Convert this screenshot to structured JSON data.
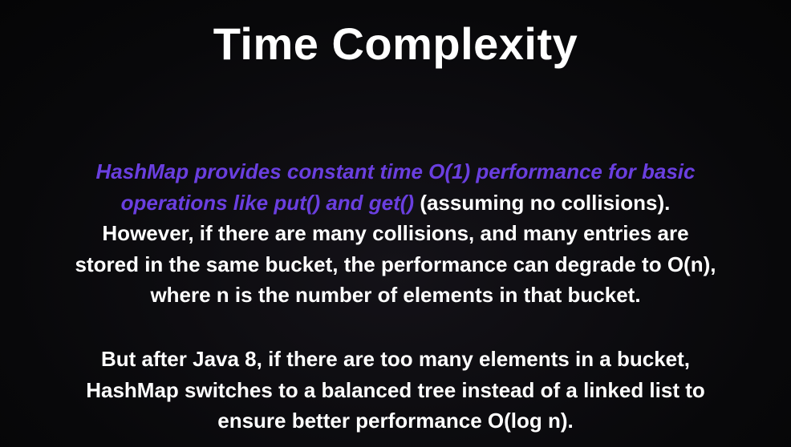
{
  "title": "Time Complexity",
  "paragraph1": {
    "highlight_line1": "HashMap provides constant time O(1) performance for basic",
    "highlight_line2": "operations like put() and get()",
    "line2_rest": " (assuming no collisions).",
    "line3": "However, if there are many collisions, and many entries are",
    "line4": "stored in the same bucket, the performance can degrade to O(n),",
    "line5": "where n is the number of elements in that bucket."
  },
  "paragraph2": {
    "line1": "But after Java 8, if there are too many elements in a bucket,",
    "line2": "HashMap switches to a balanced tree instead of a linked list to",
    "line3": "ensure better performance O(log n)."
  },
  "colors": {
    "highlight": "#6a3fe0",
    "text": "#ffffff",
    "background": "#08080a"
  }
}
